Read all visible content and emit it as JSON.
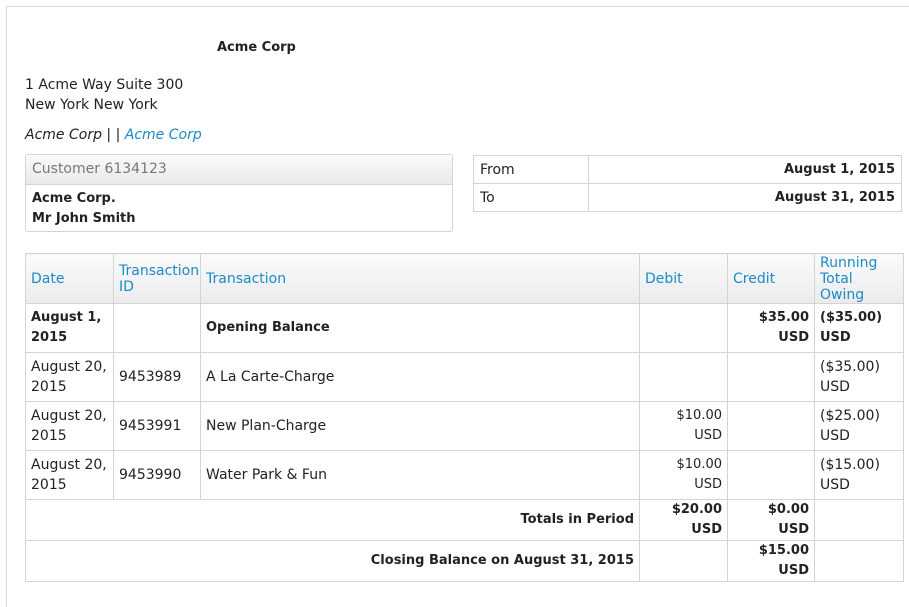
{
  "company": {
    "name": "Acme Corp",
    "address_line1": "1 Acme Way Suite 300",
    "address_line2": "New York New York",
    "links_text": "Acme Corp | |",
    "link_label": "Acme Corp"
  },
  "customer": {
    "header": "Customer 6134123",
    "line1": "Acme Corp.",
    "line2": "Mr John Smith"
  },
  "period": {
    "from_label": "From",
    "from_value": "August 1, 2015",
    "to_label": "To",
    "to_value": "August 31, 2015"
  },
  "table": {
    "columns": [
      "Date",
      "Transaction ID",
      "Transaction",
      "Debit",
      "Credit",
      "Running Total Owing"
    ],
    "rows": [
      {
        "date": "August 1, 2015",
        "id": "",
        "transaction": "Opening Balance",
        "debit": "",
        "credit": "$35.00 USD",
        "running": "($35.00) USD"
      },
      {
        "date": "August 20, 2015",
        "id": "9453989",
        "transaction": "A La Carte-Charge",
        "debit": "",
        "credit": "",
        "running": "($35.00) USD"
      },
      {
        "date": "August 20, 2015",
        "id": "9453991",
        "transaction": "New Plan-Charge",
        "debit": "$10.00 USD",
        "credit": "",
        "running": "($25.00) USD"
      },
      {
        "date": "August 20, 2015",
        "id": "9453990",
        "transaction": "Water Park & Fun",
        "debit": "$10.00 USD",
        "credit": "",
        "running": "($15.00) USD"
      }
    ],
    "totals": {
      "label": "Totals in Period",
      "debit": "$20.00 USD",
      "credit": "$0.00 USD"
    },
    "closing": {
      "label": "Closing Balance on August 31, 2015",
      "credit": "$15.00 USD"
    }
  }
}
